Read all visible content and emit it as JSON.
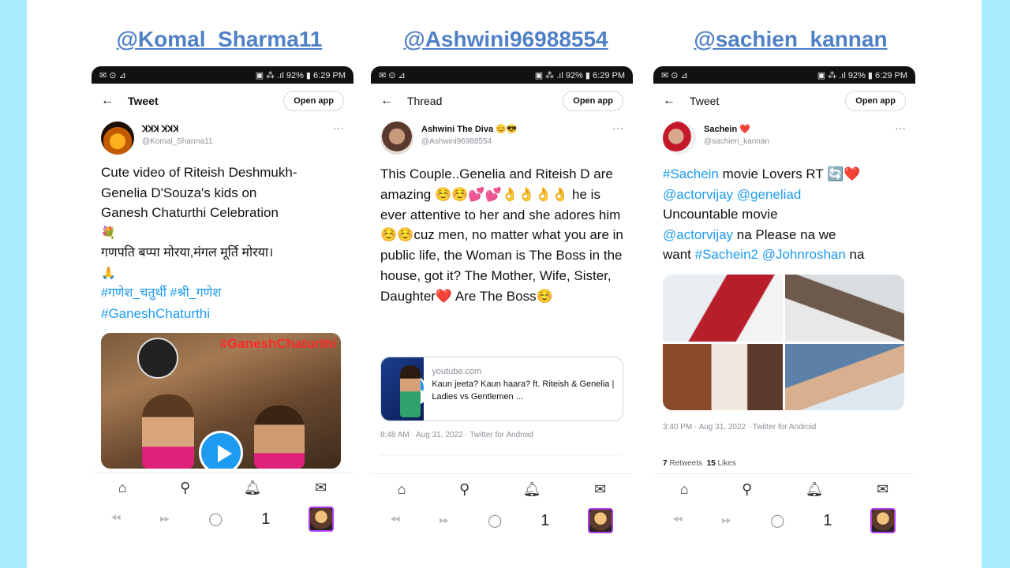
{
  "handles": [
    "@Komal_Sharma11",
    "@Ashwini96988554",
    "@sachien_kannan"
  ],
  "phones": [
    {
      "status_left": "✉ ⊙ ⊿",
      "status_right": "▣ ⁂ .ıl 92% ▮ 6:29 PM",
      "header_title": "Tweet",
      "open_app": "Open app",
      "display_name": "ꓘꓘꓘ ꓘꓘꓘ",
      "username": "@Komal_Sharma11",
      "text_lines": [
        "Cute video of Riteish Deshmukh-",
        "Genelia D'Souza's kids on",
        "Ganesh Chaturthi Celebration",
        "💐",
        "गणपति बप्पा मोरया,मंगल मूर्ति मोरया।",
        "🙏"
      ],
      "hashtags_line1": "#गणेश_चतुर्थी #श्री_गणेश",
      "hashtags_line2": "#GaneshChaturthi",
      "media_overlay": "#GaneshChaturthi"
    },
    {
      "status_left": "✉ ⊙ ⊿",
      "status_right": "▣ ⁂ .ıl 92% ▮ 6:29 PM",
      "header_title": "Thread",
      "open_app": "Open app",
      "display_name": "Ashwini The Diva 😊😎",
      "username": "@Ashwini96988554",
      "text": "This Couple..Genelia and Riteish D are amazing ☺️☺️💕💕👌👌👌👌 he is ever attentive to her and she adores him☺️☺️cuz men, no matter what you are in public life, the Woman is The Boss in the house, got it? The Mother, Wife, Sister, Daughter❤️ Are The Boss☺️",
      "card_domain": "youtube.com",
      "card_title": "Kaun jeeta? Kaun haara? ft. Riteish & Genelia | Ladies vs Gentlemen ...",
      "meta": "8:48 AM · Aug 31, 2022 · Twitter for Android"
    },
    {
      "status_left": "✉ ⊙ ⊿",
      "status_right": "▣ ⁂ .ıl 92% ▮ 6:29 PM",
      "header_title": "Tweet",
      "open_app": "Open app",
      "display_name": "Sachein ❤️",
      "username": "@sachien_kannan",
      "line1_tag": "#Sachein",
      "line1_rest": " movie Lovers RT 🔄❤️",
      "line2": "@actorvijay @geneliad",
      "line3": "Uncountable movie",
      "line4_tag": "@actorvijay",
      "line4_rest": " na Please na we",
      "line5_a": "want ",
      "line5_tag1": "#Sachein2",
      "line5_sp": " ",
      "line5_tag2": "@Johnroshan",
      "line5_rest": " na",
      "meta": "3:40 PM · Aug 31, 2022 · Twitter for Android",
      "retweets_count": "7",
      "retweets_label": " Retweets",
      "likes_count": "15",
      "likes_label": " Likes"
    }
  ],
  "nav_icons": [
    "home-icon",
    "search-icon",
    "bell-icon",
    "mail-icon"
  ],
  "tab_count": "1",
  "colors": {
    "link": "#1d9bf0",
    "handle": "#4f80c6",
    "background": "#a6ecfb"
  }
}
